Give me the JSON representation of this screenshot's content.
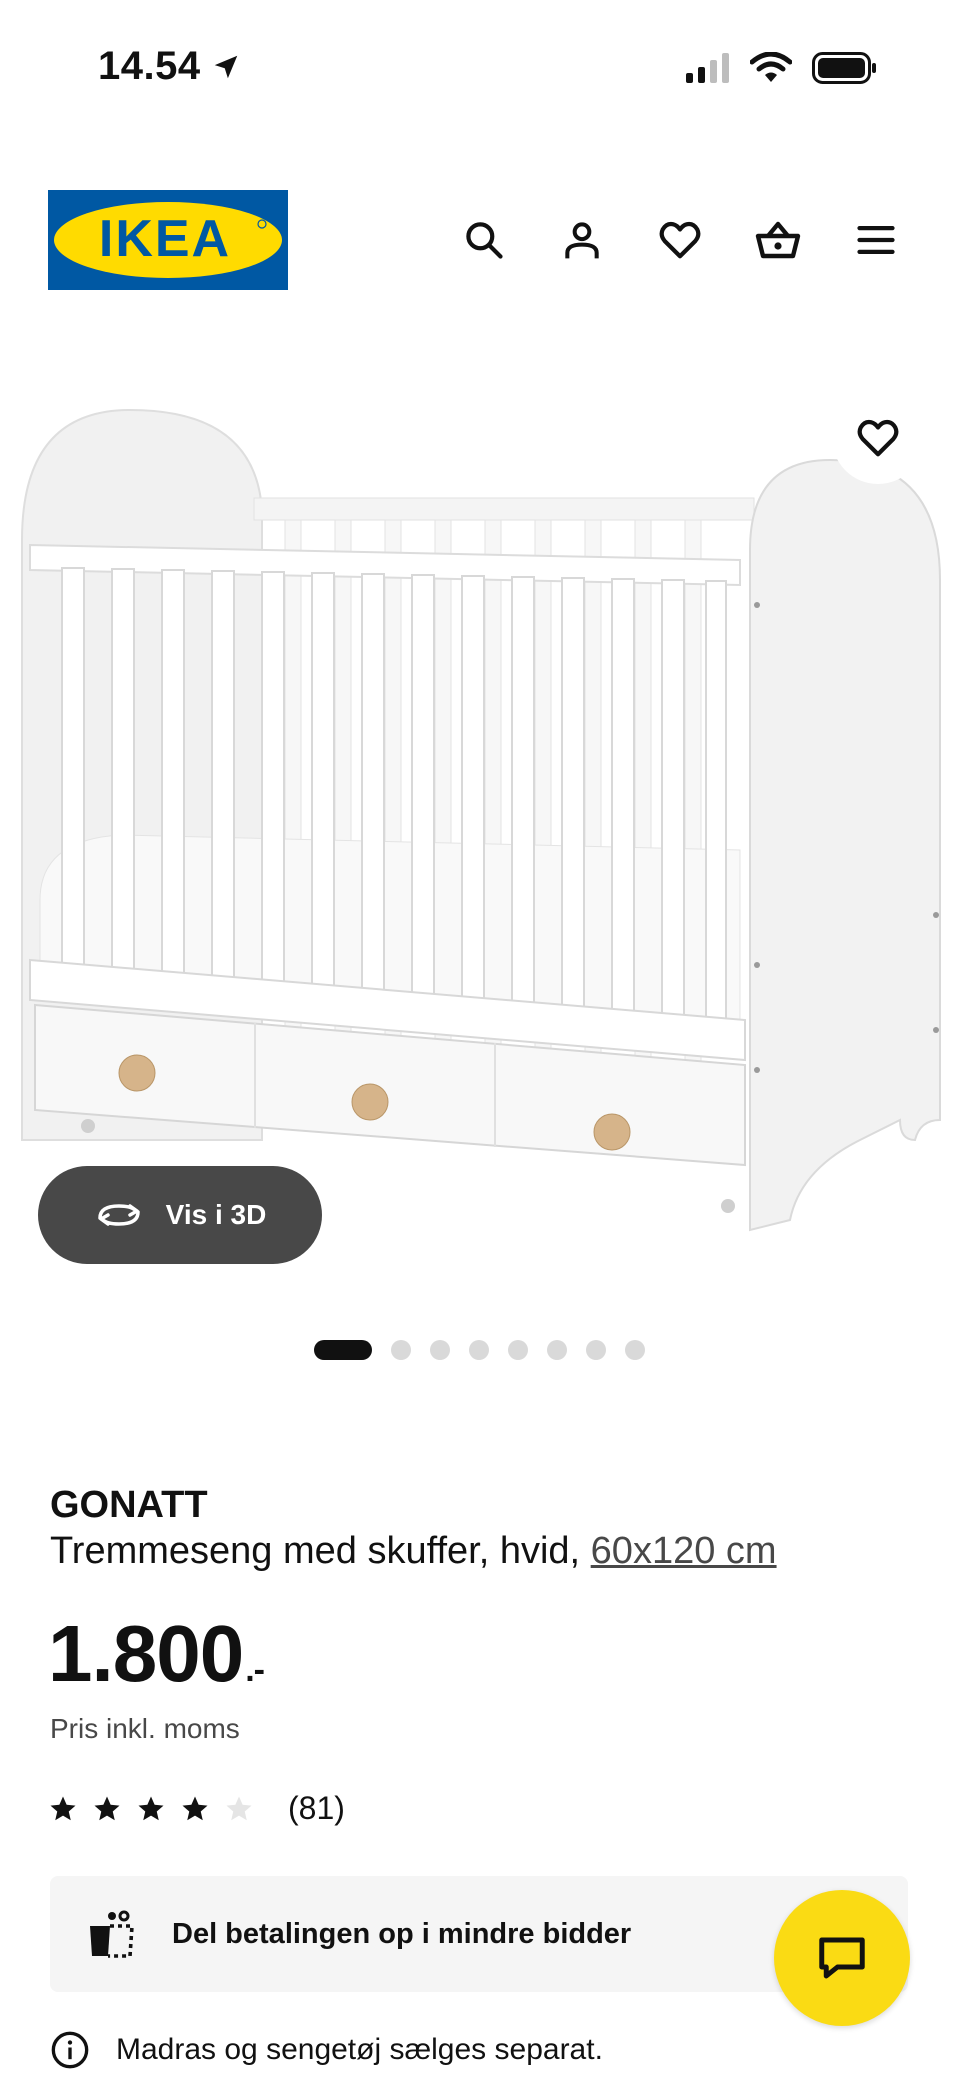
{
  "status_bar": {
    "time": "14.54",
    "icons": [
      "location-arrow-icon",
      "cellular-signal-icon",
      "wifi-icon",
      "battery-icon"
    ]
  },
  "header": {
    "logo_text": "IKEA",
    "logo_colors": {
      "blue": "#0058a3",
      "yellow": "#ffdb00"
    },
    "icons": [
      "search-icon",
      "user-icon",
      "heart-icon",
      "basket-icon",
      "menu-icon"
    ]
  },
  "gallery": {
    "vis3d_label": "Vis i 3D",
    "total_images": 8,
    "active_index": 0
  },
  "product": {
    "name": "GONATT",
    "description": "Tremmeseng med skuffer, hvid,",
    "size": "60x120 cm",
    "price": "1.800",
    "price_suffix": ".-",
    "price_note": "Pris inkl. moms",
    "rating_value": 4,
    "rating_max": 5,
    "rating_count": "(81)"
  },
  "payment_banner": {
    "text": "Del betalingen op i mindre bidder"
  },
  "notice": {
    "text": "Madras og sengetøj sælges separat."
  },
  "colors": {
    "accent_yellow": "#fadb14",
    "dark_button": "#484848",
    "banner_bg": "#f5f5f5"
  }
}
